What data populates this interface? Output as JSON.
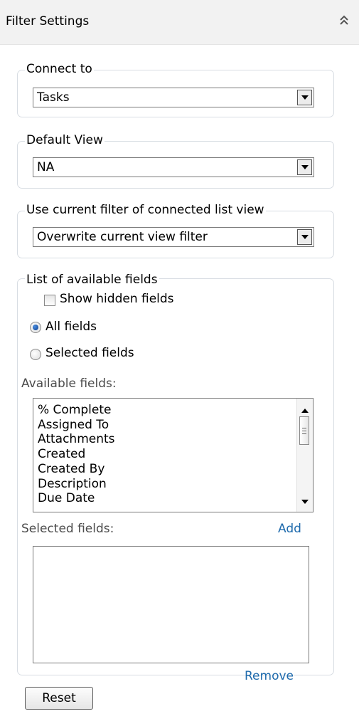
{
  "header": {
    "title": "Filter Settings",
    "collapse_icon": "double-chevron-up-icon"
  },
  "connect_to": {
    "legend": "Connect to",
    "selected": "Tasks"
  },
  "default_view": {
    "legend": "Default View",
    "selected": "NA"
  },
  "current_filter": {
    "legend": "Use current filter of connected list view",
    "selected": "Overwrite current view filter"
  },
  "fields": {
    "legend": "List of available fields",
    "show_hidden_label": "Show hidden fields",
    "show_hidden_checked": false,
    "all_fields_label": "All fields",
    "selected_fields_label": "Selected fields",
    "selected_option": "All fields",
    "available_label": "Available fields:",
    "available_items": [
      "% Complete",
      "Assigned To",
      "Attachments",
      "Created",
      "Created By",
      "Description",
      "Due Date"
    ],
    "selected_label": "Selected fields:",
    "add_link": "Add",
    "remove_link": "Remove"
  },
  "reset_button": "Reset",
  "colors": {
    "link": "#1f6bad",
    "header_bg": "#f2f2f2",
    "group_border": "#d8dde3"
  }
}
